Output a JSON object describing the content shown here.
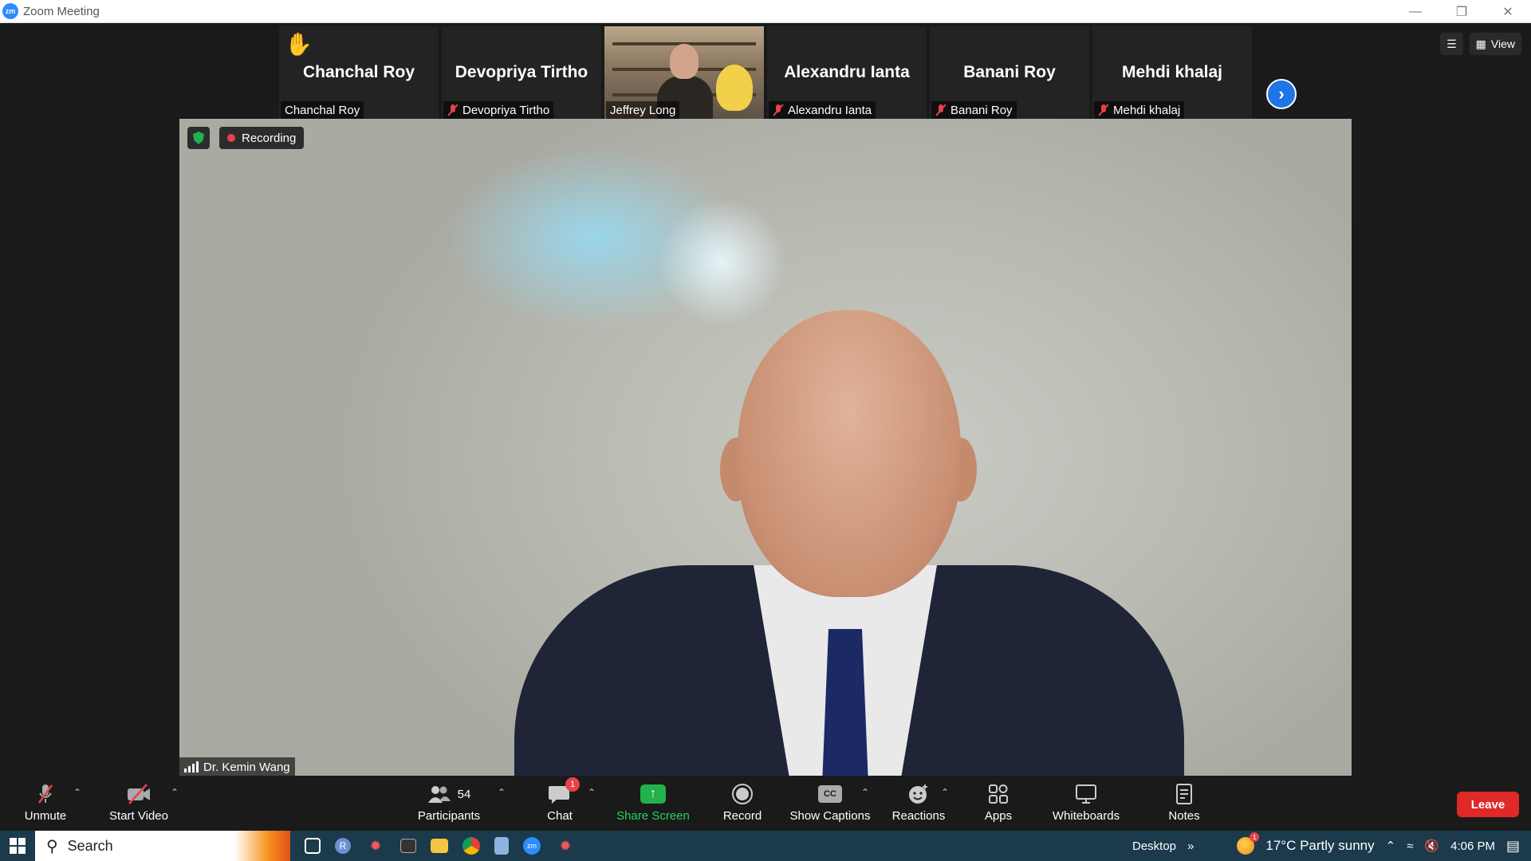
{
  "window": {
    "title": "Zoom Meeting",
    "logo_text": "zm"
  },
  "participants_strip": [
    {
      "big_name": "Chanchal Roy",
      "tag": "Chanchal Roy",
      "muted": false,
      "hand_raised": true
    },
    {
      "big_name": "Devopriya Tirtho",
      "tag": "Devopriya Tirtho",
      "muted": true
    },
    {
      "big_name": "",
      "tag": "Jeffrey Long",
      "muted": false,
      "video": true
    },
    {
      "big_name": "Alexandru Ianta",
      "tag": "Alexandru Ianta",
      "muted": true
    },
    {
      "big_name": "Banani Roy",
      "tag": "Banani Roy",
      "muted": true
    },
    {
      "big_name": "Mehdi khalaj",
      "tag": "Mehdi khalaj",
      "muted": true
    }
  ],
  "top_right": {
    "view_label": "View"
  },
  "main_video": {
    "recording_label": "Recording",
    "speaker_name": "Dr. Kemin Wang"
  },
  "toolbar": {
    "unmute": "Unmute",
    "start_video": "Start Video",
    "participants": "Participants",
    "participants_count": "54",
    "chat": "Chat",
    "chat_badge": "1",
    "share_screen": "Share Screen",
    "record": "Record",
    "show_captions": "Show Captions",
    "cc_text": "CC",
    "reactions": "Reactions",
    "apps": "Apps",
    "whiteboards": "Whiteboards",
    "notes": "Notes",
    "leave": "Leave"
  },
  "taskbar": {
    "search": "Search",
    "desktop": "Desktop",
    "weather_badge": "1",
    "weather": "17°C  Partly sunny",
    "time": "4:06 PM",
    "zoom_app_text": "zm",
    "r_app_text": "R"
  },
  "colors": {
    "accent": "#2d8cff",
    "leave": "#e02828",
    "share": "#22b14c",
    "muted": "#e8414a"
  }
}
